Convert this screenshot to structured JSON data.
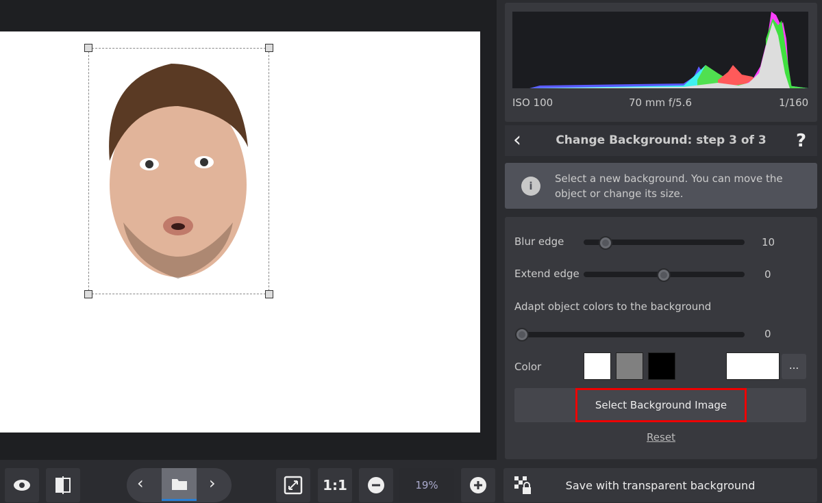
{
  "histogram": {
    "iso": "ISO 100",
    "lens": "70 mm f/5.6",
    "shutter": "1/160"
  },
  "header": {
    "title": "Change Background: step 3 of 3",
    "help": "?",
    "back": "‹"
  },
  "info": {
    "text": "Select a new background. You can move the object or change its size."
  },
  "controls": {
    "blur": {
      "label": "Blur edge",
      "value": "10",
      "fraction": 0.14
    },
    "extend": {
      "label": "Extend edge",
      "value": "0",
      "fraction": 0.5
    },
    "adapt": {
      "label": "Adapt object colors to the background",
      "value": "0",
      "fraction": 0.0
    },
    "color": {
      "label": "Color",
      "swatches": [
        "#ffffff",
        "#808080",
        "#000000"
      ],
      "current": "#ffffff",
      "more": "..."
    },
    "select_bg": "Select Background Image",
    "reset": "Reset"
  },
  "toolbar": {
    "zoom": "19%",
    "one_to_one": "1:1",
    "save": "Save with transparent background"
  },
  "colors": {
    "highlight": "#e00000",
    "accent": "#2a7fd4"
  }
}
